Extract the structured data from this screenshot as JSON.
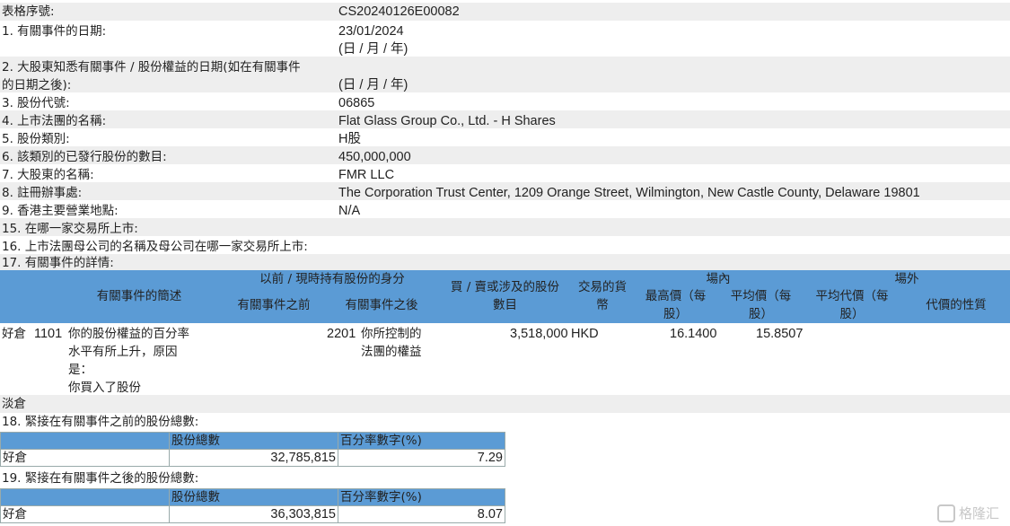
{
  "fields": [
    {
      "label": "表格序號:",
      "value": "CS20240126E00082"
    },
    {
      "label": "1. 有關事件的日期:",
      "value": "23/01/2024\n(日 / 月 / 年)"
    },
    {
      "label": "2. 大股東知悉有關事件 / 股份權益的日期(如在有關事件\n的日期之後):",
      "value": "\n(日 / 月 / 年)"
    },
    {
      "label": "3. 股份代號:",
      "value": "06865"
    },
    {
      "label": "4. 上市法團的名稱:",
      "value": "Flat Glass Group Co., Ltd. - H Shares"
    },
    {
      "label": "5. 股份類別:",
      "value": "H股"
    },
    {
      "label": "6. 該類別的已發行股份的數目:",
      "value": "450,000,000"
    },
    {
      "label": "7. 大股東的名稱:",
      "value": "FMR LLC"
    },
    {
      "label": "8. 註冊辦事處:",
      "value": "The Corporation Trust Center, 1209 Orange Street, Wilmington, New Castle County, Delaware 19801"
    },
    {
      "label": "9. 香港主要營業地點:",
      "value": "N/A"
    },
    {
      "label": "15. 在哪一家交易所上市:",
      "value": ""
    },
    {
      "label": "16. 上市法團母公司的名稱及母公司在哪一家交易所上市:",
      "value": ""
    },
    {
      "label": "17. 有關事件的詳情:",
      "value": ""
    }
  ],
  "event_table": {
    "headers": {
      "desc": "有關事件的簡述",
      "capacity": "以前 / 現時持有股份的身分",
      "before": "有關事件之前",
      "after": "有關事件之後",
      "shares": "買 / 賣或涉及的股份\n數目",
      "currency": "交易的貨\n幣",
      "onex": "場內",
      "high": "最高價（每\n股）",
      "avg": "平均價（每\n股）",
      "offex": "場外",
      "offavg": "平均代價（每\n股）",
      "nature": "代價的性質"
    },
    "row": {
      "position": "好倉",
      "code": "1101",
      "desc": "你的股份權益的百分率\n水平有所上升，原因\n是：\n你買入了股份",
      "after_code": "2201",
      "after_desc": "你所控制的\n法團的權益",
      "shares": "3,518,000",
      "currency": "HKD",
      "high": "16.1400",
      "avg": "15.8507"
    },
    "short_label": "淡倉"
  },
  "section18": {
    "title": "18. 緊接在有關事件之前的股份總數:",
    "col1": "股份總數",
    "col2": "百分率數字(%)",
    "rowlabel": "好倉",
    "total": "32,785,815",
    "pct": "7.29"
  },
  "section19": {
    "title": "19. 緊接在有關事件之後的股份總數:",
    "col1": "股份總數",
    "col2": "百分率數字(%)",
    "rowlabel": "好倉",
    "total": "36,303,815",
    "pct": "8.07"
  },
  "watermark": "格隆汇"
}
